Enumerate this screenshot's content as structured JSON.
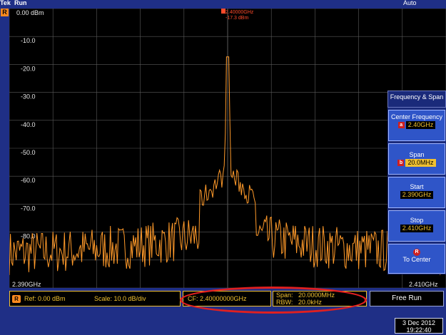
{
  "top": {
    "brand": "Tek",
    "acq_state": "Run",
    "trigger_mode": "Auto"
  },
  "ref_marker": "R",
  "screen": {
    "y_labels": [
      "0.00 dBm",
      "-10.0",
      "-20.0",
      "-30.0",
      "-40.0",
      "-50.0",
      "-60.0",
      "-70.0",
      "-80.0"
    ],
    "x_start": "2.390GHz",
    "x_stop": "2.410GHz",
    "marker_freq": "2.40000GHz",
    "marker_level": "-17.3 dBm"
  },
  "status": {
    "ref_icon": "R",
    "ref": "Ref: 0.00 dBm",
    "scale": "Scale: 10.0 dB/div",
    "cf": "CF: 2.40000000GHz",
    "span": "Span:   20.0000MHz",
    "rbw": "RBW:   20.0kHz",
    "free_run": "Free Run"
  },
  "menu": {
    "title": "Frequency & Span",
    "items": [
      {
        "label": "Center Frequency",
        "tag": "a",
        "value": "2.40GHz"
      },
      {
        "label": "Span",
        "tag": "b",
        "value": "20.0MHz"
      },
      {
        "label": "Start",
        "value": "2.390GHz"
      },
      {
        "label": "Stop",
        "value": "2.410GHz"
      },
      {
        "icon": "R",
        "label": "To Center"
      }
    ]
  },
  "datetime": {
    "date": "3 Dec 2012",
    "time": "19:22:40"
  },
  "colors": {
    "trace": "#ff9a2a",
    "grid": "#5a5a5a",
    "accent": "#f0c030",
    "bg": "#1f2f86",
    "highlight_ellipse": "#e02020"
  }
}
